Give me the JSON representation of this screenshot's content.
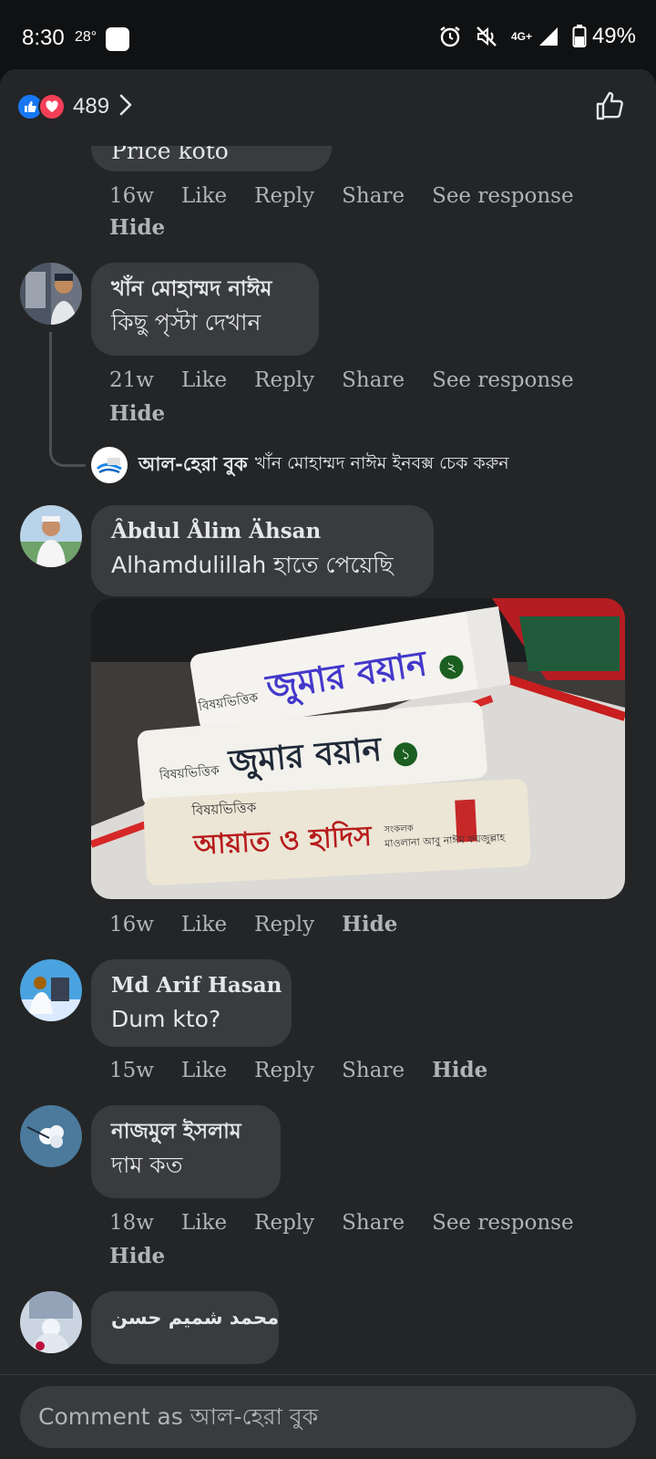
{
  "status_bar": {
    "time": "8:30",
    "temperature": "28°",
    "network": "4G+",
    "battery": "49%"
  },
  "header": {
    "reaction_count": "489"
  },
  "comments": [
    {
      "text": "Price koto",
      "age": "16w",
      "like": "Like",
      "reply": "Reply",
      "share": "Share",
      "see_response": "See response",
      "hide": "Hide"
    },
    {
      "name": "খাঁন মোহাম্মদ নাঈম",
      "text": "কিছু পৃস্টা দেখান",
      "age": "21w",
      "like": "Like",
      "reply": "Reply",
      "share": "Share",
      "see_response": "See response",
      "hide": "Hide",
      "reply_preview": {
        "name": "আল-হেরা বুক",
        "text": "খাঁন মোহাম্মদ নাঈম ইনবক্স চেক করুন"
      }
    },
    {
      "name": "Âbdul Ålim Ähsan",
      "text": "Alhamdulillah হাতে পেয়েছি",
      "age": "16w",
      "like": "Like",
      "reply": "Reply",
      "hide": "Hide",
      "photo_books": [
        {
          "top": "বিষয়ভিত্তিক",
          "title": "জুমার বয়ান",
          "vol": "২"
        },
        {
          "top": "বিষয়ভিত্তিক",
          "title": "জুমার বয়ান",
          "vol": "১"
        },
        {
          "top": "বিষয়ভিত্তিক",
          "title": "আয়াত ও হাদিস",
          "author_label": "সংকলক",
          "author": "মাওলানা আবু নাঈম ফয়জুল্লাহ"
        }
      ]
    },
    {
      "name": "Md Arif Hasan",
      "text": "Dum kto?",
      "age": "15w",
      "like": "Like",
      "reply": "Reply",
      "share": "Share",
      "hide": "Hide"
    },
    {
      "name": "নাজমুল ইসলাম",
      "text": "দাম কত",
      "age": "18w",
      "like": "Like",
      "reply": "Reply",
      "share": "Share",
      "see_response": "See response",
      "hide": "Hide"
    },
    {
      "name": "محمد شميم حسن"
    }
  ],
  "composer": {
    "placeholder": "Comment as আল-হেরা বুক"
  },
  "colors": {
    "background": "#242526",
    "bubble": "#3a3b3c",
    "text": "#e4e6eb",
    "muted": "#b0b3b8",
    "like_blue": "#1877f2",
    "love_red": "#f33e58"
  }
}
